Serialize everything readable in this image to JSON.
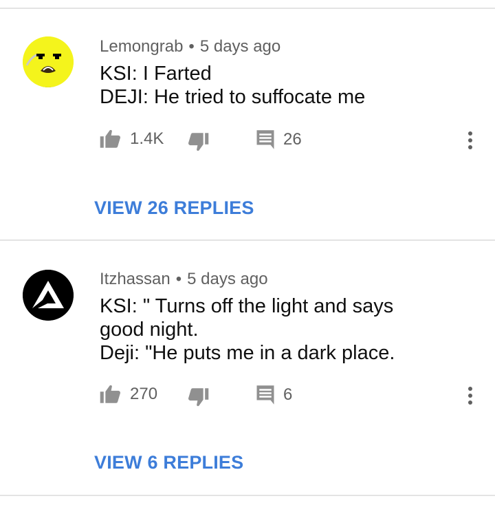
{
  "comments": [
    {
      "author": "Lemongrab",
      "separator": "•",
      "time": "5 days ago",
      "lines": [
        "KSI: I Farted",
        "DEJI: He tried to suffocate me"
      ],
      "likes": "1.4K",
      "reply_count": "26",
      "view_replies_label": "VIEW 26 REPLIES",
      "avatar": "lemongrab-face",
      "avatar_color": "#f4f41c"
    },
    {
      "author": "Itzhassan",
      "separator": "•",
      "time": "5 days ago",
      "lines": [
        "KSI: \" Turns off the light and says",
        "good night.",
        "Deji: \"He puts me in a dark place."
      ],
      "likes": "270",
      "reply_count": "6",
      "view_replies_label": "VIEW 6 REPLIES",
      "avatar": "triangle-logo",
      "avatar_color": "#000000"
    }
  ],
  "icons": {
    "like": "thumbs-up-icon",
    "dislike": "thumbs-down-icon",
    "reply": "comment-icon",
    "more": "more-vert-icon"
  },
  "colors": {
    "link": "#3d7dd9",
    "meta_text": "#606060",
    "divider": "#e3e3e3"
  }
}
